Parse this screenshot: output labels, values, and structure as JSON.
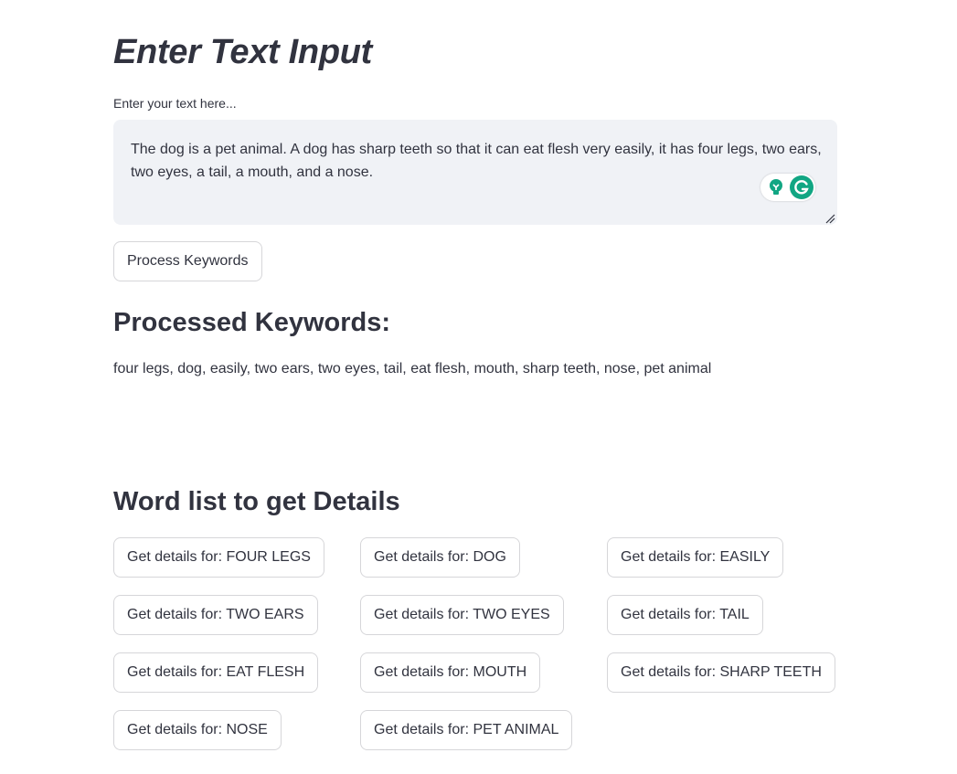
{
  "input_section": {
    "title": "Enter Text Input",
    "label": "Enter your text here...",
    "value": "The dog is a pet animal. A dog has sharp teeth so that it can eat flesh very easily, it has four legs, two ears, two eyes, a tail, a mouth, and a nose."
  },
  "process_button": {
    "label": "Process Keywords"
  },
  "processed": {
    "heading": "Processed Keywords:",
    "keywords": "four legs, dog, easily, two ears, two eyes, tail, eat flesh, mouth, sharp teeth, nose, pet animal"
  },
  "word_list": {
    "heading": "Word list to get Details",
    "buttons": [
      "Get details for: FOUR LEGS",
      "Get details for: DOG",
      "Get details for: EASILY",
      "Get details for: TWO EARS",
      "Get details for: TWO EYES",
      "Get details for: TAIL",
      "Get details for: EAT FLESH",
      "Get details for: MOUTH",
      "Get details for: SHARP TEETH",
      "Get details for: NOSE",
      "Get details for: PET ANIMAL"
    ]
  },
  "icons": {
    "grammarly_suggest": "lightbulb-icon",
    "grammarly_logo": "grammarly-logo-icon",
    "resize": "resize-grip-icon"
  },
  "colors": {
    "grammarly_green": "#11a683",
    "grammarly_dark": "#15c39a",
    "text": "#31333f",
    "input_bg": "#f0f2f6",
    "button_border": "#d6d6d9"
  }
}
